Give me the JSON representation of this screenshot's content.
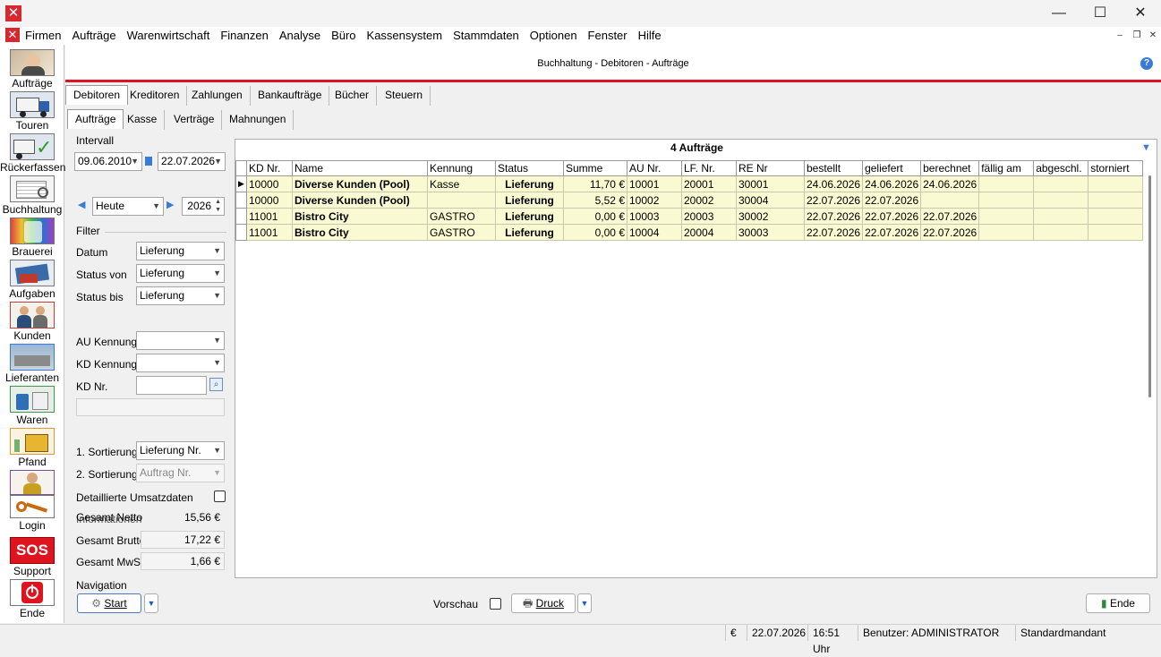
{
  "window": {
    "minimize": "—",
    "maximize": "☐",
    "close": "✕"
  },
  "menu": {
    "items": [
      "Firmen",
      "Aufträge",
      "Warenwirtschaft",
      "Finanzen",
      "Analyse",
      "Büro",
      "Kassensystem",
      "Stammdaten",
      "Optionen",
      "Fenster",
      "Hilfe"
    ],
    "mdi_min": "–",
    "mdi_restore": "❐",
    "mdi_close": "✕"
  },
  "sidebar": {
    "items": [
      {
        "label": "Aufträge",
        "icon": "headset-agent-icon"
      },
      {
        "label": "Touren",
        "icon": "truck-icon"
      },
      {
        "label": "Rückerfassen",
        "icon": "truck-check-icon"
      },
      {
        "label": "Buchhaltung",
        "icon": "ledger-icon"
      },
      {
        "label": "Brauerei",
        "icon": "brewery-icon"
      },
      {
        "label": "Aufgaben",
        "icon": "tasks-icon"
      },
      {
        "label": "Kunden",
        "icon": "customers-icon"
      },
      {
        "label": "Lieferanten",
        "icon": "suppliers-icon"
      },
      {
        "label": "Waren",
        "icon": "goods-icon"
      },
      {
        "label": "Pfand",
        "icon": "crate-icon"
      },
      {
        "label": "Login",
        "icon": "key-icon"
      },
      {
        "label": "Support",
        "icon": "sos-icon",
        "badge": "SOS"
      },
      {
        "label": "Ende",
        "icon": "power-icon"
      }
    ]
  },
  "header": {
    "title": "Buchhaltung - Debitoren - Aufträge",
    "help": "?"
  },
  "tabs": {
    "main": [
      "Debitoren",
      "Kreditoren",
      "Zahlungen",
      "Bankaufträge",
      "Bücher",
      "Steuern"
    ],
    "sub": [
      "Aufträge",
      "Kasse",
      "Verträge",
      "Mahnungen"
    ]
  },
  "filters": {
    "intervall_label": "Intervall",
    "date_from": "09.06.2010",
    "date_to": "22.07.2026",
    "period": "Heute",
    "year": "2026",
    "filter_label": "Filter",
    "datum_label": "Datum",
    "datum_value": "Lieferung",
    "status_von_label": "Status von",
    "status_von_value": "Lieferung",
    "status_bis_label": "Status bis",
    "status_bis_value": "Lieferung",
    "au_kennung_label": "AU Kennung",
    "au_kennung_value": "",
    "kd_kennung_label": "KD Kennung",
    "kd_kennung_value": "",
    "kd_nr_label": "KD Nr.",
    "kd_nr_value": "",
    "sort1_label": "1. Sortierung",
    "sort1_value": "Lieferung Nr.",
    "sort2_label": "2. Sortierung",
    "sort2_value": "Auftrag Nr.",
    "detail_label": "Detaillierte Umsatzdaten"
  },
  "info": {
    "label": "Informationen",
    "netto_label": "Gesamt Netto",
    "netto_value": "15,56 €",
    "brutto_label": "Gesamt Brutto",
    "brutto_value": "17,22 €",
    "mwst_label": "Gesamt MwSt.",
    "mwst_value": "1,66 €"
  },
  "grid": {
    "title": "4 Aufträge",
    "columns": [
      "KD Nr.",
      "Name",
      "Kennung",
      "Status",
      "Summe",
      "AU Nr.",
      "LF. Nr.",
      "RE Nr",
      "bestellt",
      "geliefert",
      "berechnet",
      "fällig am",
      "abgeschl.",
      "storniert"
    ],
    "rows": [
      {
        "kd": "10000",
        "name": "Diverse Kunden (Pool)",
        "kennung": "Kasse",
        "status": "Lieferung",
        "summe": "11,70 €",
        "au": "10001",
        "lf": "20001",
        "re": "30001",
        "bestellt": "24.06.2026",
        "geliefert": "24.06.2026",
        "berechnet": "24.06.2026",
        "faellig": "",
        "abgeschl": "",
        "storniert": ""
      },
      {
        "kd": "10000",
        "name": "Diverse Kunden (Pool)",
        "kennung": "",
        "status": "Lieferung",
        "summe": "5,52 €",
        "au": "10002",
        "lf": "20002",
        "re": "30004",
        "bestellt": "22.07.2026",
        "geliefert": "22.07.2026",
        "berechnet": "",
        "faellig": "",
        "abgeschl": "",
        "storniert": ""
      },
      {
        "kd": "11001",
        "name": "Bistro City",
        "kennung": "GASTRO",
        "status": "Lieferung",
        "summe": "0,00 €",
        "au": "10003",
        "lf": "20003",
        "re": "30002",
        "bestellt": "22.07.2026",
        "geliefert": "22.07.2026",
        "berechnet": "22.07.2026",
        "faellig": "",
        "abgeschl": "",
        "storniert": ""
      },
      {
        "kd": "11001",
        "name": "Bistro City",
        "kennung": "GASTRO",
        "status": "Lieferung",
        "summe": "0,00 €",
        "au": "10004",
        "lf": "20004",
        "re": "30003",
        "bestellt": "22.07.2026",
        "geliefert": "22.07.2026",
        "berechnet": "22.07.2026",
        "faellig": "",
        "abgeschl": "",
        "storniert": ""
      }
    ]
  },
  "navigation": {
    "label": "Navigation",
    "start": "Start",
    "vorschau": "Vorschau",
    "druck": "Druck",
    "ende": "Ende"
  },
  "status": {
    "currency": "€",
    "date": "22.07.2026",
    "time": "16:51 Uhr",
    "user": "Benutzer: ADMINISTRATOR",
    "mandant": "Standardmandant"
  },
  "colors": {
    "accent_red": "#e0141e",
    "row_highlight": "#fafad2",
    "link_blue": "#1f5fb5"
  }
}
